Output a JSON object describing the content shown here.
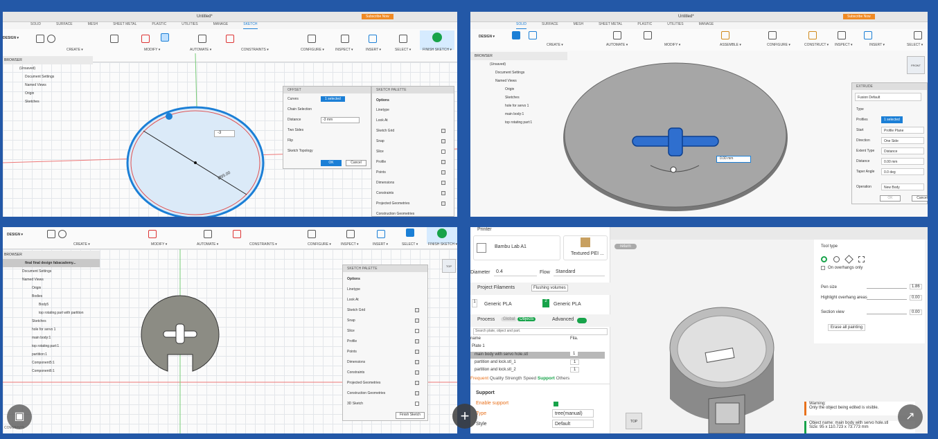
{
  "q1": {
    "title": "Untitled*",
    "subscribe": "Subscribe Now",
    "tabs": [
      "SOLID",
      "SURFACE",
      "MESH",
      "SHEET METAL",
      "PLASTIC",
      "UTILITIES",
      "MANAGE",
      "SKETCH"
    ],
    "workspace": "DESIGN ▾",
    "groups": [
      "CREATE ▾",
      "MODIFY ▾",
      "AUTOMATE ▾",
      "CONSTRAINTS ▾",
      "CONFIGURE ▾",
      "INSPECT ▾",
      "INSERT ▾",
      "SELECT ▾",
      "FINISH SKETCH ▾"
    ],
    "browser_title": "BROWSER",
    "browser": [
      "(Unsaved)",
      "Document Settings",
      "Named Views",
      "Origin",
      "Sketches"
    ],
    "offset_title": "OFFSET",
    "offset_rows": [
      "Curves",
      "Chain Selection",
      "Distance",
      "Two Sides",
      "Flip",
      "Sketch Topology"
    ],
    "offset_selected": "1 selected",
    "offset_value": "-3 mm",
    "ok": "OK",
    "cancel": "Cancel",
    "dim_input": "-3",
    "diameter": "Ø95.00",
    "palette_title": "SKETCH PALETTE",
    "palette_options": "Options",
    "palette_rows": [
      "Linetype",
      "Look At",
      "Sketch Grid",
      "Snap",
      "Slice",
      "Profile",
      "Points",
      "Dimensions",
      "Constraints",
      "Projected Geometries",
      "Construction Geometries"
    ]
  },
  "q2": {
    "title": "Untitled*",
    "subscribe": "Subscribe Now",
    "tabs": [
      "SOLID",
      "SURFACE",
      "MESH",
      "SHEET METAL",
      "PLASTIC",
      "UTILITIES",
      "MANAGE"
    ],
    "workspace": "DESIGN ▾",
    "groups": [
      "CREATE ▾",
      "AUTOMATE ▾",
      "MODIFY ▾",
      "ASSEMBLE ▾",
      "CONFIGURE ▾",
      "CONSTRUCT ▾",
      "INSPECT ▾",
      "INSERT ▾",
      "SELECT ▾"
    ],
    "browser_title": "BROWSER",
    "browser": [
      "(Unsaved)",
      "Document Settings",
      "Named Views",
      "Origin",
      "Sketches",
      "hole for servo 1",
      "main body:1",
      "top rotating part:1"
    ],
    "extrude_title": "EXTRUDE",
    "tool_default": "Fusion Default",
    "rows": [
      {
        "k": "Type",
        "v": ""
      },
      {
        "k": "Profiles",
        "v": "1 selected"
      },
      {
        "k": "Start",
        "v": "Profile Plane"
      },
      {
        "k": "Direction",
        "v": "One Side"
      },
      {
        "k": "Extent Type",
        "v": "Distance"
      },
      {
        "k": "Distance",
        "v": "0.00 mm"
      },
      {
        "k": "Taper Angle",
        "v": "0.0 deg"
      },
      {
        "k": "Operation",
        "v": "New Body"
      }
    ],
    "ok": "OK",
    "cancel": "Cancel",
    "dim_input": "0.00 mm",
    "viewcube": "FRONT"
  },
  "q3": {
    "workspace": "DESIGN ▾",
    "groups": [
      "CREATE ▾",
      "MODIFY ▾",
      "AUTOMATE ▾",
      "CONSTRAINTS ▾",
      "CONFIGURE ▾",
      "INSPECT ▾",
      "INSERT ▾",
      "SELECT ▾",
      "FINISH SKETCH ▾"
    ],
    "browser_title": "BROWSER",
    "browser": [
      "final final design fabacademy...",
      "Document Settings",
      "Named Views",
      "Origin",
      "Bodies",
      "Body5",
      "top rotating part with partition",
      "Sketches",
      "hole for servo 1",
      "main body:1",
      "top rotating part:1",
      "partition:1",
      "Component5:1",
      "Component6:1"
    ],
    "palette_title": "SKETCH PALETTE",
    "palette_options": "Options",
    "palette_rows": [
      "Linetype",
      "Look At",
      "Sketch Grid",
      "Snap",
      "Slice",
      "Profile",
      "Points",
      "Dimensions",
      "Constraints",
      "Projected Geometries",
      "Construction Geometries",
      "3D Sketch"
    ],
    "finish_btn": "Finish Sketch",
    "comments": "COMMENTS",
    "viewcube": "TOP"
  },
  "q4": {
    "printer_hdr": "Printer",
    "printer": "Bambu Lab A1",
    "plate": "Textured PEI ...",
    "diameter_label": "Diameter",
    "diameter_value": "0.4",
    "flow_label": "Flow",
    "flow_value": "Standard",
    "filaments_title": "Project Filaments",
    "flushing": "Flushing volumes",
    "filaments": [
      {
        "n": "1",
        "name": "Generic PLA"
      },
      {
        "n": "2",
        "name": "Generic PLA"
      }
    ],
    "process_title": "Process",
    "global": "Global",
    "objects": "Objects",
    "advanced": "Advanced",
    "search": "Search plate, object and part.",
    "col_name": "name",
    "col_fila": "Fila.",
    "plate_label": "Plate 1",
    "objects_list": [
      {
        "name": "main body with servo hole.stl",
        "f": "1"
      },
      {
        "name": "partition and lock.stl_1",
        "f": "1"
      },
      {
        "name": "partition and lock.stl_2",
        "f": "1"
      }
    ],
    "proc_tabs": [
      "Frequent",
      "Quality",
      "Strength",
      "Speed",
      "Support",
      "Others"
    ],
    "support_title": "Support",
    "enable_support": "Enable support",
    "type_label": "Type",
    "type_value": "tree(manual)",
    "style_label": "Style",
    "style_value": "Default",
    "return": "return",
    "tool_type": "Tool type",
    "overhangs": "On overhangs only",
    "pen_size": "Pen size",
    "pen_val": "1.86",
    "highlight": "Highlight overhang areas",
    "highlight_val": "0.00",
    "section": "Section view",
    "section_val": "0.00",
    "erase": "Erase all painting",
    "warning": "Warning:",
    "warning_text": "Only the object being edited is visible.",
    "object_name": "Object name: main body with servo hole.stl",
    "size": "Size: 95 x 110.723 x 73.773 mm",
    "viewcube": "TOP"
  },
  "colors": {
    "bg": "#2358a7",
    "accent": "#1b7fd6",
    "green": "#17a34a",
    "orange": "#e8711c"
  }
}
